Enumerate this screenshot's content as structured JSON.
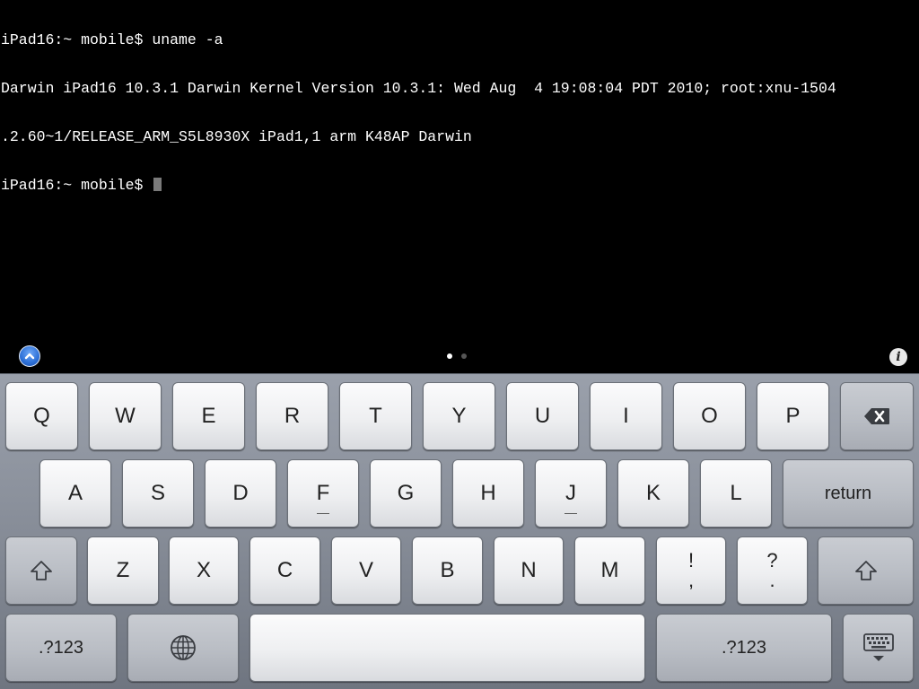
{
  "terminal": {
    "lines": [
      "iPad16:~ mobile$ uname -a",
      "Darwin iPad16 10.3.1 Darwin Kernel Version 10.3.1: Wed Aug  4 19:08:04 PDT 2010; root:xnu-1504",
      ".2.60~1/RELEASE_ARM_S5L8930X iPad1,1 arm K48AP Darwin"
    ],
    "prompt": "iPad16:~ mobile$ "
  },
  "accessory": {
    "toggle_icon": "chevron-up-icon",
    "info_label": "i",
    "pages": 2,
    "active_page": 1
  },
  "keyboard": {
    "row1": [
      "Q",
      "W",
      "E",
      "R",
      "T",
      "Y",
      "U",
      "I",
      "O",
      "P"
    ],
    "row2": [
      "A",
      "S",
      "D",
      "F",
      "G",
      "H",
      "J",
      "K",
      "L"
    ],
    "row3": [
      "Z",
      "X",
      "C",
      "V",
      "B",
      "N",
      "M"
    ],
    "punct1_top": "!",
    "punct1_bottom": ",",
    "punct2_top": "?",
    "punct2_bottom": ".",
    "return_label": "return",
    "numbers_label": ".?123",
    "numbers_label_right": ".?123",
    "space_label": "",
    "delete_icon": "backspace-icon",
    "shift_icon": "shift-icon",
    "globe_icon": "globe-icon",
    "hide_icon": "keyboard-hide-icon"
  },
  "colors": {
    "terminal_bg": "#000000",
    "terminal_fg": "#ffffff",
    "cursor": "#7a7a7a",
    "keyboard_bg": "#8b919c",
    "accent_blue": "#2c6fd6"
  }
}
